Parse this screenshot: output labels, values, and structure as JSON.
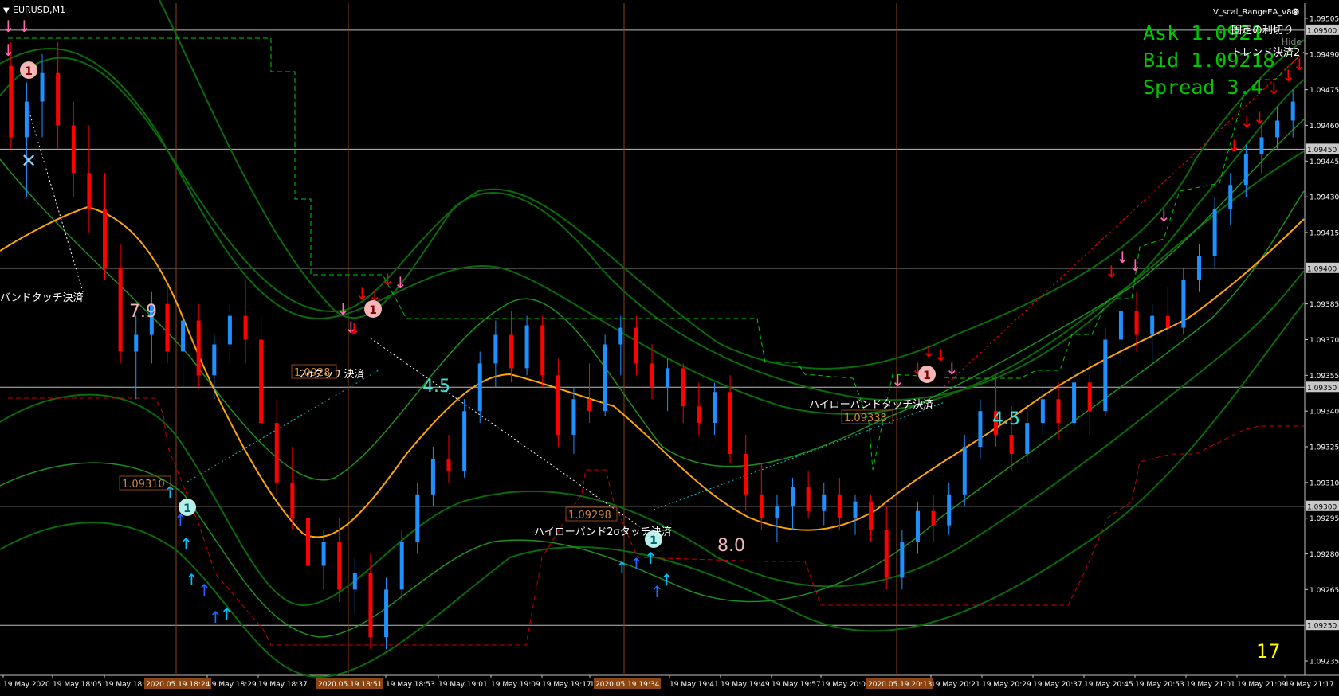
{
  "window": {
    "symbol_label": "EURUSD,M1",
    "ea_label": "V_scal_RangeEA_v8.2",
    "close_icon": "close-circle-icon",
    "menu_icon": "triangle-down-icon"
  },
  "overlay": {
    "ask_text": "Ask 1.0921",
    "bid_text": "Bid 1.09218",
    "spread_text": "Spread 3.4",
    "jp_fixed": "固定の利切り",
    "jp_trend": "トレンド決済2",
    "hide_label": "Hide",
    "bar_counter": "17",
    "colors": {
      "overlay_text": "#00c800",
      "counter": "#ffff00"
    }
  },
  "price_scale": {
    "ticks": [
      "1.09505",
      "1.09490",
      "1.09475",
      "1.09460",
      "1.09445",
      "1.09430",
      "1.09415",
      "1.09385",
      "1.09370",
      "1.09355",
      "1.09340",
      "1.09325",
      "1.09310",
      "1.09295",
      "1.09280",
      "1.09265",
      "1.09235"
    ],
    "round_levels": [
      "1.09500",
      "1.09450",
      "1.09400",
      "1.09350",
      "1.09300",
      "1.09250"
    ]
  },
  "time_axis": {
    "labels": [
      "19 May 2020",
      "19 May 18:05",
      "19 May 18:",
      "19 May 18:29",
      "19 May 18:37",
      "19 May 18:53",
      "19 May 19:01",
      "19 May 19:09",
      "19 May 19:17",
      "19 May",
      "19 May 19:41",
      "19 May 19:49",
      "19 May 19:57",
      "19 May 20:05",
      "19 May 20:21",
      "19 May 20:29",
      "19 May 20:37",
      "19 May 20:45",
      "19 May 20:53",
      "19 May 21:01",
      "19 May 21:09",
      "19 May 21:17"
    ],
    "highlight_labels": [
      "2020.05.19 18:24",
      "2020.05.19 18:51",
      "2020.05.19 19:34",
      "2020.05.19 20:13"
    ]
  },
  "annotations": {
    "band_touch_left": "バンドタッチ決済",
    "two_touch_1": "2σタッチ決済",
    "two_touch_2": "ハイローバンド2σタッチ決済",
    "hilo_touch": "ハイローバンドタッチ決済",
    "num_79": "7.9",
    "num_45a": "4.5",
    "num_80": "8.0",
    "num_45b": "4.5",
    "price_labels": [
      "1.09310",
      "1.09298",
      "1.09338",
      "1.0928"
    ],
    "circle_one": "1"
  },
  "chart_data": {
    "type": "candlestick",
    "symbol": "EURUSD",
    "timeframe": "M1",
    "y_range": [
      1.0923,
      1.0951
    ],
    "round_levels": [
      1.095,
      1.0945,
      1.094,
      1.0935,
      1.093,
      1.0925
    ],
    "period_separators": [
      "2020.05.19 18:24",
      "2020.05.19 18:51",
      "2020.05.19 19:34",
      "2020.05.19 20:13"
    ],
    "colors": {
      "bull": "#1e90ff",
      "bear": "#ff0000",
      "ma": "#ffa500",
      "bands": "#006400",
      "inner_band": "#228b22",
      "dashed_upper": "#00c800",
      "dashed_lower": "#cc0000"
    },
    "candles": [
      {
        "o": 1.09485,
        "h": 1.09495,
        "l": 1.0945,
        "c": 1.09455
      },
      {
        "o": 1.09455,
        "h": 1.09478,
        "l": 1.0943,
        "c": 1.0947
      },
      {
        "o": 1.0947,
        "h": 1.0949,
        "l": 1.09455,
        "c": 1.09482
      },
      {
        "o": 1.09482,
        "h": 1.09495,
        "l": 1.0945,
        "c": 1.0946
      },
      {
        "o": 1.0946,
        "h": 1.0947,
        "l": 1.0943,
        "c": 1.0944
      },
      {
        "o": 1.0944,
        "h": 1.0946,
        "l": 1.09415,
        "c": 1.09425
      },
      {
        "o": 1.09425,
        "h": 1.0944,
        "l": 1.09395,
        "c": 1.094
      },
      {
        "o": 1.094,
        "h": 1.0941,
        "l": 1.0936,
        "c": 1.09365
      },
      {
        "o": 1.09365,
        "h": 1.0938,
        "l": 1.09345,
        "c": 1.09372
      },
      {
        "o": 1.09372,
        "h": 1.0939,
        "l": 1.0936,
        "c": 1.09385
      },
      {
        "o": 1.09385,
        "h": 1.09392,
        "l": 1.0936,
        "c": 1.09365
      },
      {
        "o": 1.09365,
        "h": 1.09382,
        "l": 1.0935,
        "c": 1.09378
      },
      {
        "o": 1.09378,
        "h": 1.09385,
        "l": 1.0935,
        "c": 1.09355
      },
      {
        "o": 1.09355,
        "h": 1.09372,
        "l": 1.09345,
        "c": 1.09368
      },
      {
        "o": 1.09368,
        "h": 1.09385,
        "l": 1.0936,
        "c": 1.0938
      },
      {
        "o": 1.0938,
        "h": 1.09395,
        "l": 1.0936,
        "c": 1.0937
      },
      {
        "o": 1.0937,
        "h": 1.0938,
        "l": 1.0933,
        "c": 1.09335
      },
      {
        "o": 1.09335,
        "h": 1.09345,
        "l": 1.09305,
        "c": 1.0931
      },
      {
        "o": 1.0931,
        "h": 1.09325,
        "l": 1.0929,
        "c": 1.09295
      },
      {
        "o": 1.09295,
        "h": 1.09305,
        "l": 1.0927,
        "c": 1.09275
      },
      {
        "o": 1.09275,
        "h": 1.0929,
        "l": 1.09265,
        "c": 1.09285
      },
      {
        "o": 1.09285,
        "h": 1.09295,
        "l": 1.0926,
        "c": 1.09265
      },
      {
        "o": 1.09265,
        "h": 1.09278,
        "l": 1.09255,
        "c": 1.09272
      },
      {
        "o": 1.09272,
        "h": 1.0928,
        "l": 1.0924,
        "c": 1.09245
      },
      {
        "o": 1.09245,
        "h": 1.0927,
        "l": 1.0924,
        "c": 1.09265
      },
      {
        "o": 1.09265,
        "h": 1.0929,
        "l": 1.0926,
        "c": 1.09285
      },
      {
        "o": 1.09285,
        "h": 1.0931,
        "l": 1.0928,
        "c": 1.09305
      },
      {
        "o": 1.09305,
        "h": 1.09325,
        "l": 1.093,
        "c": 1.0932
      },
      {
        "o": 1.0932,
        "h": 1.0933,
        "l": 1.0931,
        "c": 1.09315
      },
      {
        "o": 1.09315,
        "h": 1.09345,
        "l": 1.09312,
        "c": 1.0934
      },
      {
        "o": 1.0934,
        "h": 1.09365,
        "l": 1.09335,
        "c": 1.0936
      },
      {
        "o": 1.0936,
        "h": 1.09378,
        "l": 1.0935,
        "c": 1.09372
      },
      {
        "o": 1.09372,
        "h": 1.09382,
        "l": 1.09352,
        "c": 1.09358
      },
      {
        "o": 1.09358,
        "h": 1.0938,
        "l": 1.09355,
        "c": 1.09376
      },
      {
        "o": 1.09376,
        "h": 1.0938,
        "l": 1.0935,
        "c": 1.09355
      },
      {
        "o": 1.09355,
        "h": 1.09362,
        "l": 1.09325,
        "c": 1.0933
      },
      {
        "o": 1.0933,
        "h": 1.0935,
        "l": 1.09322,
        "c": 1.09345
      },
      {
        "o": 1.09345,
        "h": 1.0936,
        "l": 1.09335,
        "c": 1.0934
      },
      {
        "o": 1.0934,
        "h": 1.09372,
        "l": 1.09338,
        "c": 1.09368
      },
      {
        "o": 1.09368,
        "h": 1.0938,
        "l": 1.09355,
        "c": 1.09375
      },
      {
        "o": 1.09375,
        "h": 1.0938,
        "l": 1.09355,
        "c": 1.0936
      },
      {
        "o": 1.0936,
        "h": 1.09368,
        "l": 1.09345,
        "c": 1.0935
      },
      {
        "o": 1.0935,
        "h": 1.09362,
        "l": 1.0934,
        "c": 1.09358
      },
      {
        "o": 1.09358,
        "h": 1.0936,
        "l": 1.09335,
        "c": 1.09342
      },
      {
        "o": 1.09342,
        "h": 1.09352,
        "l": 1.0933,
        "c": 1.09335
      },
      {
        "o": 1.09335,
        "h": 1.09352,
        "l": 1.0933,
        "c": 1.09348
      },
      {
        "o": 1.09348,
        "h": 1.09355,
        "l": 1.09318,
        "c": 1.09322
      },
      {
        "o": 1.09322,
        "h": 1.0933,
        "l": 1.09298,
        "c": 1.09305
      },
      {
        "o": 1.09305,
        "h": 1.09318,
        "l": 1.0929,
        "c": 1.09295
      },
      {
        "o": 1.09295,
        "h": 1.09305,
        "l": 1.09285,
        "c": 1.093
      },
      {
        "o": 1.093,
        "h": 1.09312,
        "l": 1.0929,
        "c": 1.09308
      },
      {
        "o": 1.09308,
        "h": 1.09315,
        "l": 1.09295,
        "c": 1.09298
      },
      {
        "o": 1.09298,
        "h": 1.0931,
        "l": 1.09292,
        "c": 1.09305
      },
      {
        "o": 1.09305,
        "h": 1.09312,
        "l": 1.0929,
        "c": 1.09295
      },
      {
        "o": 1.09295,
        "h": 1.09305,
        "l": 1.09288,
        "c": 1.09302
      },
      {
        "o": 1.09302,
        "h": 1.09305,
        "l": 1.09285,
        "c": 1.0929
      },
      {
        "o": 1.0929,
        "h": 1.093,
        "l": 1.09265,
        "c": 1.0927
      },
      {
        "o": 1.0927,
        "h": 1.0929,
        "l": 1.09265,
        "c": 1.09285
      },
      {
        "o": 1.09285,
        "h": 1.09302,
        "l": 1.0928,
        "c": 1.09298
      },
      {
        "o": 1.09298,
        "h": 1.09305,
        "l": 1.09285,
        "c": 1.09292
      },
      {
        "o": 1.09292,
        "h": 1.0931,
        "l": 1.09288,
        "c": 1.09305
      },
      {
        "o": 1.09305,
        "h": 1.0933,
        "l": 1.093,
        "c": 1.09325
      },
      {
        "o": 1.09325,
        "h": 1.09345,
        "l": 1.0932,
        "c": 1.0934
      },
      {
        "o": 1.0934,
        "h": 1.09355,
        "l": 1.09325,
        "c": 1.0933
      },
      {
        "o": 1.0933,
        "h": 1.09342,
        "l": 1.09315,
        "c": 1.09322
      },
      {
        "o": 1.09322,
        "h": 1.0934,
        "l": 1.09318,
        "c": 1.09335
      },
      {
        "o": 1.09335,
        "h": 1.0935,
        "l": 1.0933,
        "c": 1.09345
      },
      {
        "o": 1.09345,
        "h": 1.09352,
        "l": 1.09328,
        "c": 1.09335
      },
      {
        "o": 1.09335,
        "h": 1.09358,
        "l": 1.09332,
        "c": 1.09352
      },
      {
        "o": 1.09352,
        "h": 1.09355,
        "l": 1.0933,
        "c": 1.0934
      },
      {
        "o": 1.0934,
        "h": 1.09375,
        "l": 1.09338,
        "c": 1.0937
      },
      {
        "o": 1.0937,
        "h": 1.09388,
        "l": 1.0936,
        "c": 1.09382
      },
      {
        "o": 1.09382,
        "h": 1.0939,
        "l": 1.09365,
        "c": 1.09372
      },
      {
        "o": 1.09372,
        "h": 1.09385,
        "l": 1.0936,
        "c": 1.0938
      },
      {
        "o": 1.0938,
        "h": 1.09392,
        "l": 1.0937,
        "c": 1.09375
      },
      {
        "o": 1.09375,
        "h": 1.094,
        "l": 1.09372,
        "c": 1.09395
      },
      {
        "o": 1.09395,
        "h": 1.0941,
        "l": 1.0939,
        "c": 1.09405
      },
      {
        "o": 1.09405,
        "h": 1.0943,
        "l": 1.094,
        "c": 1.09425
      },
      {
        "o": 1.09425,
        "h": 1.0944,
        "l": 1.09418,
        "c": 1.09435
      },
      {
        "o": 1.09435,
        "h": 1.09452,
        "l": 1.0943,
        "c": 1.09448
      },
      {
        "o": 1.09448,
        "h": 1.0946,
        "l": 1.0944,
        "c": 1.09455
      },
      {
        "o": 1.09455,
        "h": 1.09468,
        "l": 1.0945,
        "c": 1.09462
      },
      {
        "o": 1.09462,
        "h": 1.09475,
        "l": 1.09455,
        "c": 1.0947
      }
    ]
  }
}
